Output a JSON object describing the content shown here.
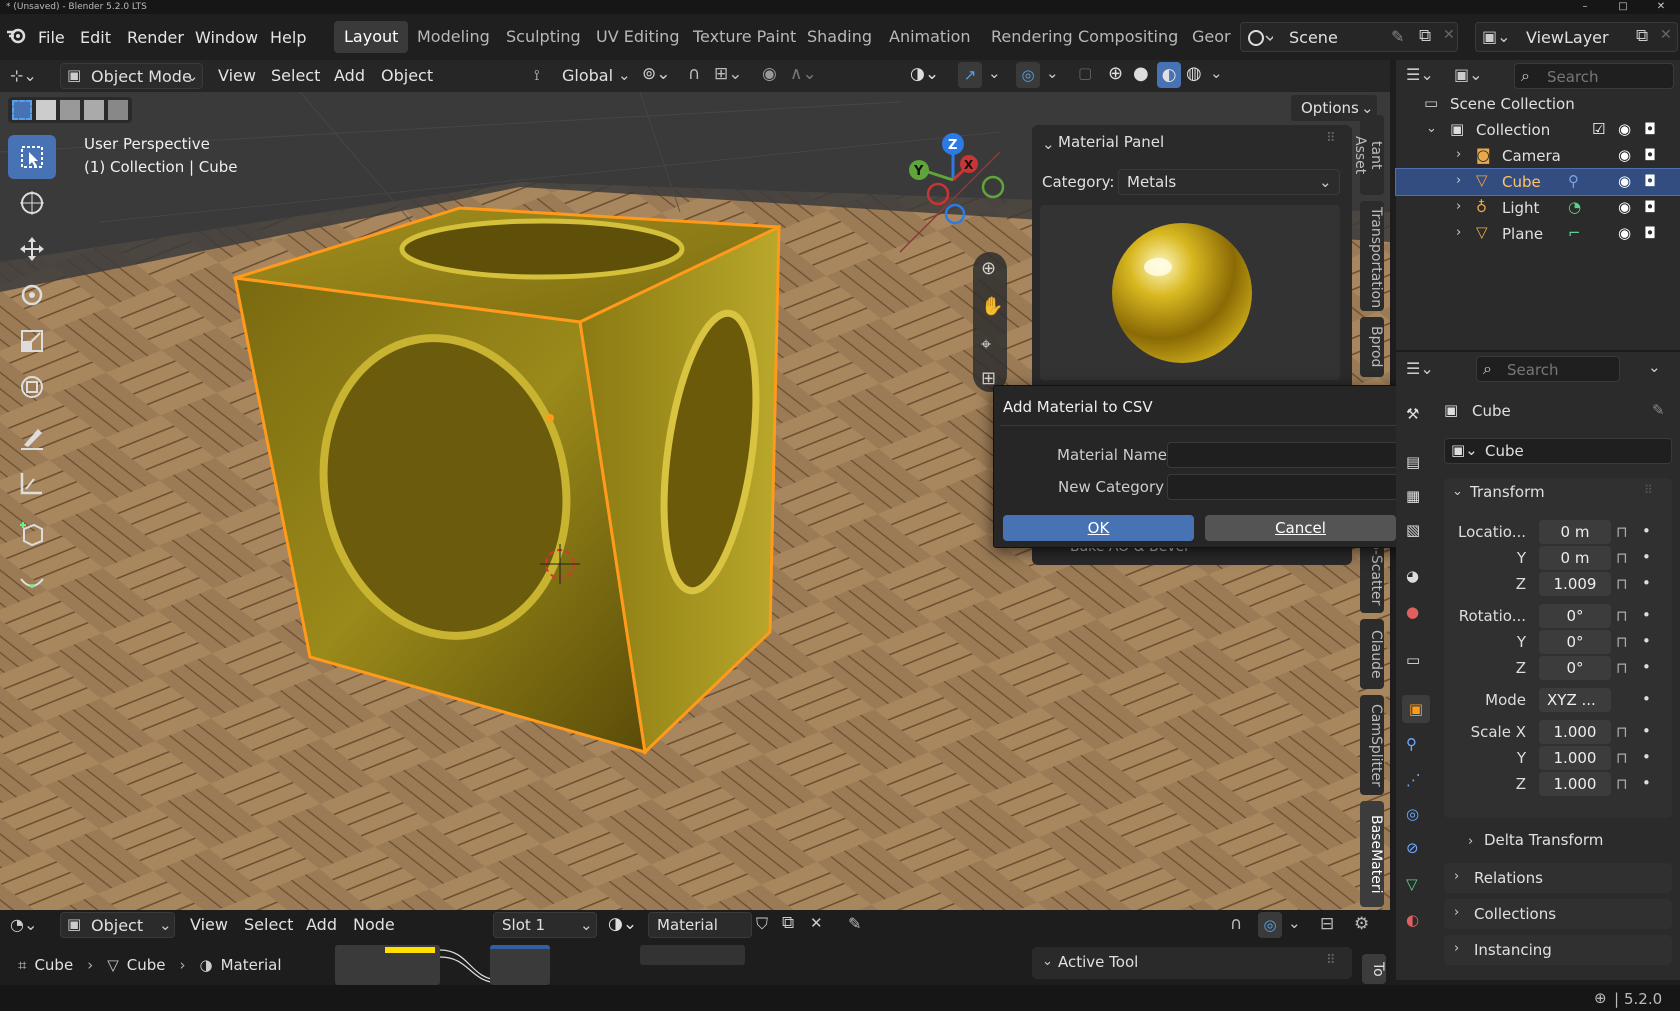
{
  "window": {
    "title": "* (Unsaved) - Blender 5.2.0 LTS",
    "min": "–",
    "max": "□",
    "close": "✕"
  },
  "menu": {
    "file": "File",
    "edit": "Edit",
    "render": "Render",
    "window": "Window",
    "help": "Help"
  },
  "workspaces": [
    "Layout",
    "Modeling",
    "Sculpting",
    "UV Editing",
    "Texture Paint",
    "Shading",
    "Animation",
    "Rendering",
    "Compositing",
    "Geor"
  ],
  "scene": {
    "name": "Scene",
    "viewlayer": "ViewLayer"
  },
  "viewport_header": {
    "mode": "Object Mode",
    "view": "View",
    "select": "Select",
    "add": "Add",
    "object": "Object",
    "orientation": "Global",
    "options": "Options"
  },
  "viewport": {
    "perspective": "User Perspective",
    "context": "(1) Collection | Cube"
  },
  "gizmo": {
    "z": "Z",
    "y": "Y",
    "x": "X"
  },
  "ntabs": [
    "tant Asset",
    "Transportation",
    "Bprod",
    "o-Scatter",
    "Claude",
    "CamSplitter",
    "BaseMateri"
  ],
  "material_panel": {
    "title": "Material Panel",
    "category_label": "Category:",
    "category_value": "Metals",
    "behind_item": "Bake AO & Bevel"
  },
  "dialog": {
    "title": "Add Material to CSV",
    "name_label": "Material Name",
    "name_value": "",
    "category_label": "New Category",
    "category_value": "",
    "ok": "OK",
    "cancel": "Cancel"
  },
  "outliner": {
    "search_placeholder": "Search",
    "root": "Scene Collection",
    "collection": "Collection",
    "items": [
      {
        "name": "Camera",
        "color": "#e8a84e"
      },
      {
        "name": "Cube",
        "color": "#e8a84e"
      },
      {
        "name": "Light",
        "color": "#e8a84e"
      },
      {
        "name": "Plane",
        "color": "#e8a84e"
      }
    ]
  },
  "properties": {
    "search_placeholder": "Search",
    "object_name": "Cube",
    "datablock": "Cube",
    "transform": {
      "title": "Transform",
      "location_label": "Locatio...",
      "location": [
        "0 m",
        "0 m",
        "1.009"
      ],
      "rotation_label": "Rotatio...",
      "rotation": [
        "0°",
        "0°",
        "0°"
      ],
      "mode_label": "Mode",
      "mode": "XYZ ...",
      "scale_label": "Scale X",
      "scale": [
        "1.000",
        "1.000",
        "1.000"
      ],
      "y": "Y",
      "z": "Z"
    },
    "delta": "Delta Transform",
    "relations": "Relations",
    "collections": "Collections",
    "instancing": "Instancing"
  },
  "node_editor": {
    "editor": "Object",
    "view": "View",
    "select": "Select",
    "add": "Add",
    "node": "Node",
    "slot": "Slot 1",
    "material": "Material",
    "active_tool": "Active Tool",
    "tool_tab": "To"
  },
  "breadcrumb": [
    "Cube",
    "Cube",
    "Material"
  ],
  "status": {
    "version": "5.2.0"
  }
}
